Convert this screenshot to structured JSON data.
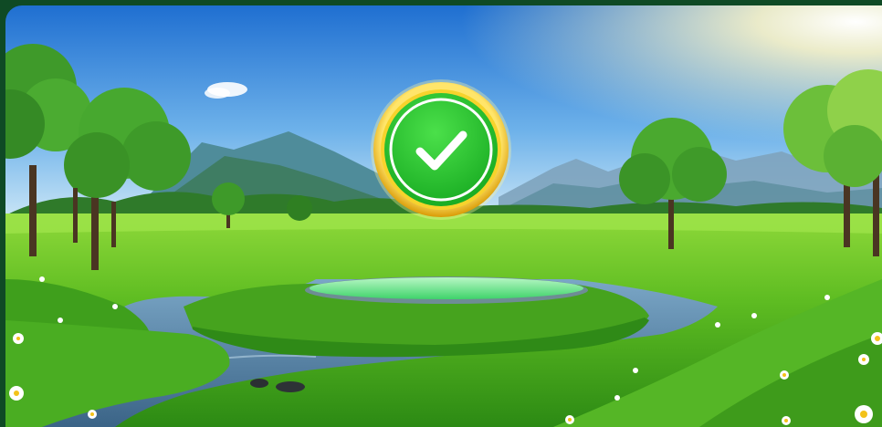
{
  "scene": {
    "description_icon": "success-checkmark-icon",
    "colors": {
      "sky_top": "#1f6fd1",
      "sky_bottom": "#cfe6f6",
      "grass_light": "#7fd12e",
      "grass_dark": "#2f8f16",
      "water": "#4e7ea3",
      "badge_green": "#22c22a",
      "badge_gold": "#f2c10f",
      "frame": "#0f4a25"
    },
    "badge": {
      "icon": "check-icon",
      "state": "success"
    }
  }
}
